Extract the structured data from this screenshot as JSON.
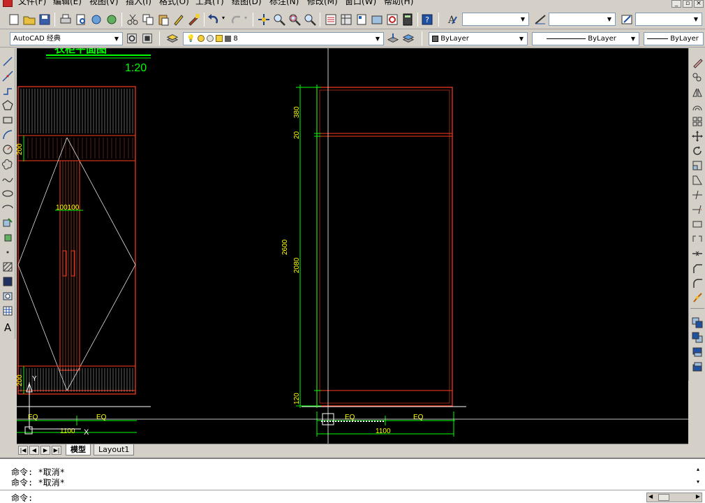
{
  "menu": {
    "items": [
      "文件(F)",
      "编辑(E)",
      "视图(V)",
      "插入(I)",
      "格式(O)",
      "工具(T)",
      "绘图(D)",
      "标注(N)",
      "修改(M)",
      "窗口(W)",
      "帮助(H)"
    ]
  },
  "workspace": {
    "value": "AutoCAD 经典"
  },
  "layer": {
    "value": "8"
  },
  "properties": {
    "color": "ByLayer",
    "linetype": "ByLayer",
    "lineweight": "ByLayer"
  },
  "drawing": {
    "title": "衣柜平面图",
    "scale": "1:20",
    "left_view": {
      "dim_top": "200",
      "dim_bottom": "200",
      "dim_door": "100100",
      "dim_eq_1": "EQ",
      "dim_eq_2": "EQ",
      "dim_width": "1100"
    },
    "right_view": {
      "dim_380": "380",
      "dim_20": "20",
      "dim_2600": "2600",
      "dim_2080": "2080",
      "dim_120": "120",
      "dim_eq_1": "EQ",
      "dim_eq_2": "EQ",
      "dim_width": "1100"
    },
    "ucs_y": "Y",
    "ucs_x": "X"
  },
  "tabs": [
    "模型",
    "Layout1"
  ],
  "command": {
    "history": [
      "命令: *取消*",
      "命令: *取消*"
    ],
    "prompt": "命令:"
  },
  "colors": {
    "canvas_bg": "#000000",
    "dimension": "#00ff00",
    "dim_text": "#ffff00",
    "furniture": "#ff3b1f",
    "wire": "#ffffff"
  }
}
